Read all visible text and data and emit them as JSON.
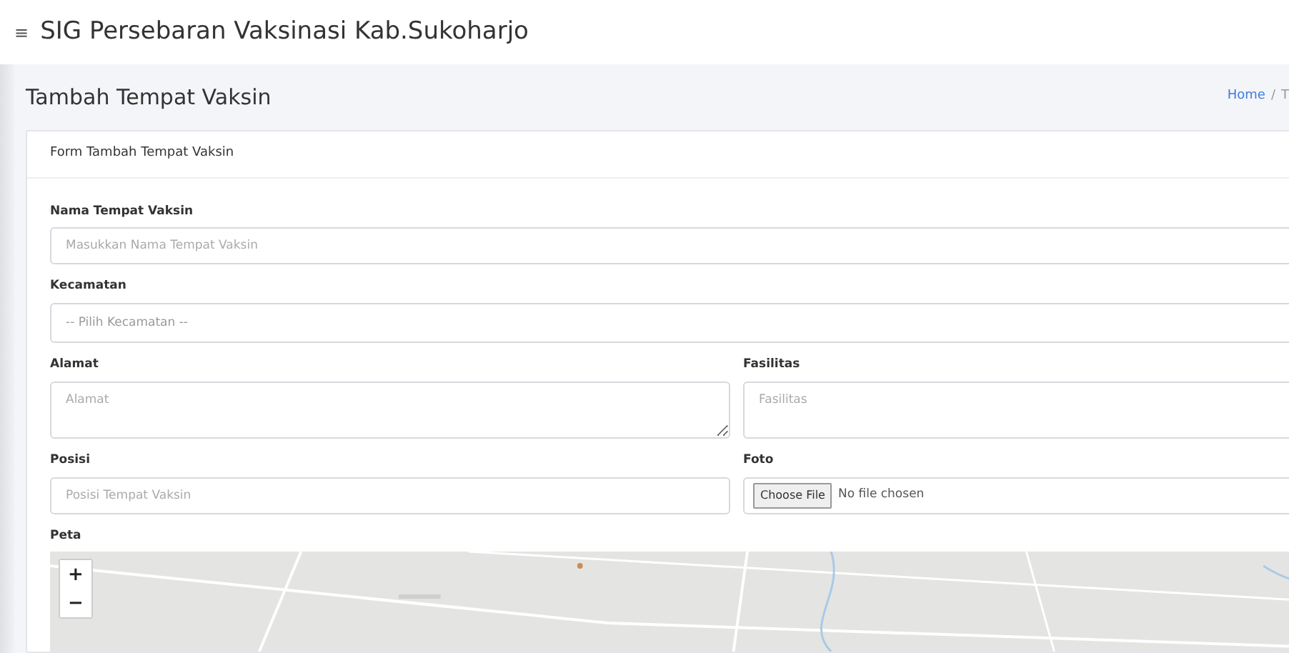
{
  "menu_glyph": "≡",
  "app_title": "SIG Persebaran Vaksinasi Kab.Sukoharjo",
  "page_title": "Tambah Tempat Vaksin",
  "breadcrumb": {
    "separator": "/",
    "items": [
      {
        "text": "Home",
        "kind": "link"
      },
      {
        "text": "T",
        "kind": "current"
      }
    ]
  },
  "card": {
    "title": "Form Tambah Tempat Vaksin",
    "rows": [
      [
        {
          "kind": "input",
          "label": "Nama Tempat Vaksin",
          "placeholder": "Masukkan Nama Tempat Vaksin"
        }
      ],
      [
        {
          "kind": "select",
          "label": "Kecamatan",
          "value": "-- Pilih Kecamatan --"
        }
      ],
      [
        {
          "kind": "textarea",
          "label": "Alamat",
          "placeholder": "Alamat"
        },
        {
          "kind": "textarea_cut",
          "label": "Fasilitas",
          "placeholder": "Fasilitas"
        }
      ],
      [
        {
          "kind": "input",
          "label": "Posisi",
          "placeholder": "Posisi Tempat Vaksin"
        },
        {
          "kind": "file",
          "label": "Foto",
          "button": "Choose File",
          "status": "No file chosen"
        }
      ]
    ],
    "map": {
      "label": "Peta",
      "zoom_in": "+",
      "zoom_out": "−"
    }
  }
}
